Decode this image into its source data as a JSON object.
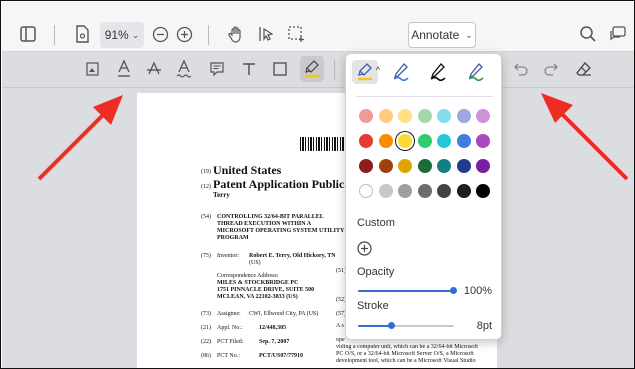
{
  "toolbar": {
    "zoom_value": "91%",
    "annotate_label": "Annotate"
  },
  "document": {
    "line_19": "(19)",
    "line_12": "(12)",
    "country": "United States",
    "pub_type": "Patent Application Publication",
    "inventor_short": "Terry",
    "n54": "(54)",
    "title_1": "CONTROLLING 32/64-BIT PARALLEL",
    "title_2": "THREAD EXECUTION WITHIN A",
    "title_3": "MICROSOFT OPERATING SYSTEM UTILITY",
    "title_4": "PROGRAM",
    "n75": "(75)",
    "inventor_label": "Inventor:",
    "inventor_value": "Robert E. Terry, Old Hickory, TN",
    "inventor_value_2": "(US)",
    "corr_label": "Correspondence Address:",
    "corr_1": "MILES & STOCKBRIDGE PC",
    "corr_2": "1751 PINNACLE DRIVE, SUITE 500",
    "corr_3": "MCLEAN, VA 22102-3833 (US)",
    "n73": "(73)",
    "assignee_label": "Assignee:",
    "assignee_value": "CWI, Ellwood City, PA (US)",
    "n21": "(21)",
    "appl_label": "Appl. No.:",
    "appl_value": "12/448,305",
    "n22": "(22)",
    "pct_filed_label": "PCT Filed:",
    "pct_filed_value": "Sep. 7, 2007",
    "n86": "(86)",
    "pct_no_label": "PCT No.:",
    "pct_no_value": "PCT/US07/77910",
    "n51": "(51)",
    "n52": "(52)",
    "n57": "(57)",
    "abs_a": "A s",
    "abs_1": "ope",
    "abs_2": "viding a computer unit, which can be a 32/64-bit Microsoft",
    "abs_3": "PC O/S, or a 32/64-bit Microsoft Server O/S, a Microsoft",
    "abs_4": "development tool, which can be a Microsoft Visual Studio"
  },
  "popover": {
    "custom_label": "Custom",
    "opacity_label": "Opacity",
    "opacity_value": "100%",
    "opacity_fraction": 1.0,
    "stroke_label": "Stroke",
    "stroke_value": "8pt",
    "stroke_fraction": 0.35,
    "swatch_colors": [
      [
        "#ef9a9a",
        "#ffcc80",
        "#ffe082",
        "#a5d6a7",
        "#80deea",
        "#9fa8da",
        "#ce93d8"
      ],
      [
        "#e53935",
        "#fb8c00",
        "#fdd835",
        "#2ecc71",
        "#26c6da",
        "#3f7fe0",
        "#ab47bc"
      ],
      [
        "#8e1d1d",
        "#a0400c",
        "#e0a400",
        "#1b6b3a",
        "#137f7f",
        "#243a8c",
        "#7b1fa2"
      ],
      [
        "#ffffff",
        "#c8c8c8",
        "#9e9e9e",
        "#6d6d6d",
        "#424242",
        "#1e1e1e",
        "#000000"
      ]
    ],
    "selected_color": "#fdd835",
    "pen_colors": [
      "#f5c518",
      "#3f7fe0",
      "#111111",
      "#2e9e4a"
    ]
  }
}
